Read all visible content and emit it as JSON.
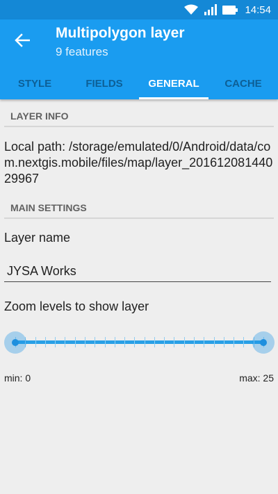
{
  "status_bar": {
    "time": "14:54",
    "icons": [
      "wifi-icon",
      "signal-icon",
      "battery-icon"
    ]
  },
  "app_bar": {
    "title": "Multipolygon layer",
    "subtitle": "9 features",
    "back_icon": "arrow-back-icon"
  },
  "tabs": [
    {
      "label": "STYLE",
      "active": false
    },
    {
      "label": "FIELDS",
      "active": false
    },
    {
      "label": "GENERAL",
      "active": true
    },
    {
      "label": "CACHE",
      "active": false
    }
  ],
  "layer_info": {
    "header": "LAYER INFO",
    "local_path": "Local path: /storage/emulated/0/Android/data/com.nextgis.mobile/files/map/layer_20161208144029967"
  },
  "main_settings": {
    "header": "MAIN SETTINGS",
    "layer_name_label": "Layer name",
    "layer_name_value": "JYSA Works",
    "zoom_label": "Zoom levels to show layer",
    "zoom_min": 0,
    "zoom_max": 25,
    "min_text": "min: 0",
    "max_text": "max: 25"
  },
  "colors": {
    "status_bar": "#1488d6",
    "app_bar": "#1a9cf0",
    "accent": "#29a0e6",
    "background": "#eeeeee"
  }
}
